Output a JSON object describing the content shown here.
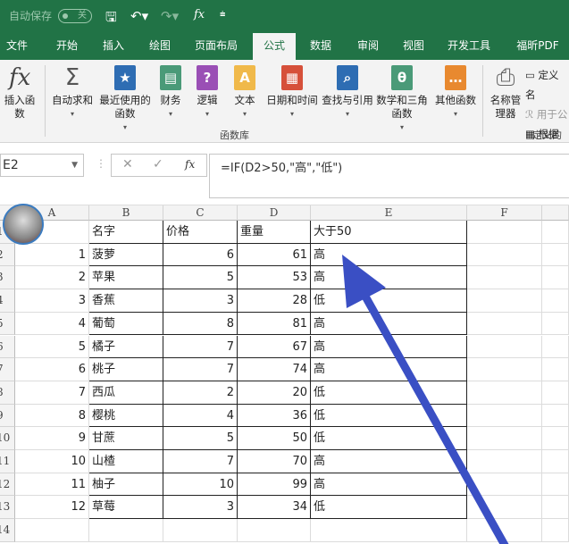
{
  "titlebar": {
    "autosave_label": "自动保存",
    "autosave_state": "关",
    "fx": "fx"
  },
  "tabs": [
    "文件",
    "开始",
    "插入",
    "绘图",
    "页面布局",
    "公式",
    "数据",
    "审阅",
    "视图",
    "开发工具",
    "福昕PDF"
  ],
  "active_tab": "公式",
  "ribbon": {
    "buttons": [
      {
        "label": "插入函数",
        "icon": "fx-icon",
        "color": "#444444"
      },
      {
        "label": "自动求和",
        "icon": "sigma-icon",
        "color": "#555555"
      },
      {
        "label": "最近使用的函数",
        "icon": "star-book-icon",
        "color": "#2e6db3"
      },
      {
        "label": "财务",
        "icon": "finance-book-icon",
        "color": "#4a9a78"
      },
      {
        "label": "逻辑",
        "icon": "question-book-icon",
        "color": "#9a4fb5"
      },
      {
        "label": "文本",
        "icon": "text-book-icon",
        "color": "#f0b94a"
      },
      {
        "label": "日期和时间",
        "icon": "calendar-book-icon",
        "color": "#d6503a"
      },
      {
        "label": "查找与引用",
        "icon": "search-book-icon",
        "color": "#2e6db3"
      },
      {
        "label": "数学和三角函数",
        "icon": "theta-book-icon",
        "color": "#4a9a78"
      },
      {
        "label": "其他函数",
        "icon": "more-book-icon",
        "color": "#e8892f"
      },
      {
        "label": "名称管理器",
        "icon": "name-manager-icon",
        "color": "#666666"
      }
    ],
    "side_items": [
      "定义名",
      "用于公",
      "根据所"
    ],
    "group_function_lib": "函数库",
    "group_defined_names": "定义的名"
  },
  "formula_bar": {
    "name_box": "E2",
    "formula": "=IF(D2>50,\"高\",\"低\")"
  },
  "columns": [
    "A",
    "B",
    "C",
    "D",
    "E",
    "F"
  ],
  "header_row": [
    "",
    "名字",
    "价格",
    "重量",
    "大于50"
  ],
  "rows": [
    [
      1,
      "菠萝",
      6,
      61,
      "高"
    ],
    [
      2,
      "苹果",
      5,
      53,
      "高"
    ],
    [
      3,
      "香蕉",
      3,
      28,
      "低"
    ],
    [
      4,
      "葡萄",
      8,
      81,
      "高"
    ],
    [
      5,
      "橘子",
      7,
      67,
      "高"
    ],
    [
      6,
      "桃子",
      7,
      74,
      "高"
    ],
    [
      7,
      "西瓜",
      2,
      20,
      "低"
    ],
    [
      8,
      "樱桃",
      4,
      36,
      "低"
    ],
    [
      9,
      "甘蔗",
      5,
      50,
      "低"
    ],
    [
      10,
      "山楂",
      7,
      70,
      "高"
    ],
    [
      11,
      "柚子",
      10,
      99,
      "高"
    ],
    [
      12,
      "草莓",
      3,
      34,
      "低"
    ]
  ],
  "row_numbers": [
    "1",
    "2",
    "3",
    "4",
    "5",
    "6",
    "7",
    "8",
    "9",
    "10",
    "11",
    "12",
    "13",
    "14"
  ],
  "accent": "#217346",
  "arrow_color": "#3a4fc4"
}
